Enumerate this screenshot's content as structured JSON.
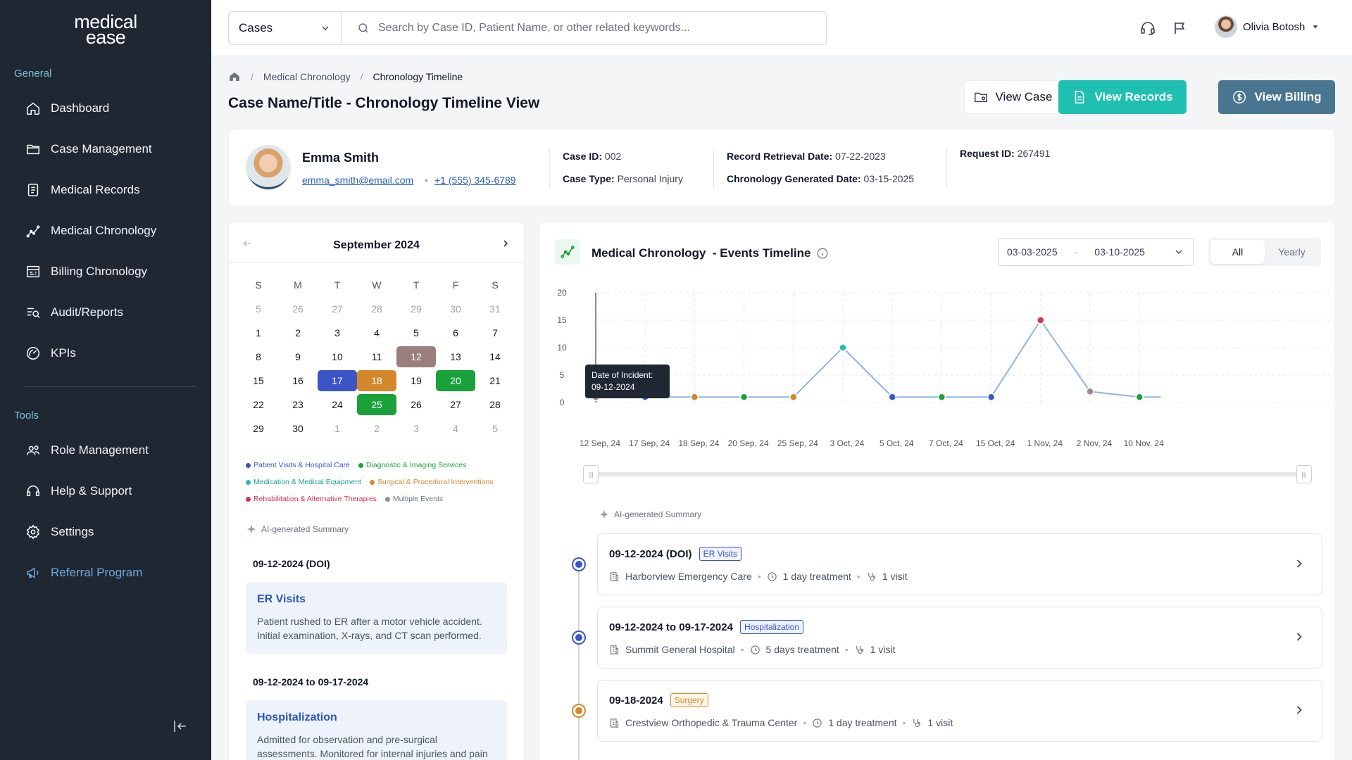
{
  "brand": {
    "line1": "medical",
    "line2": "ease"
  },
  "sidebar": {
    "general_label": "General",
    "tools_label": "Tools",
    "items": [
      {
        "label": "Dashboard",
        "icon": "home-icon"
      },
      {
        "label": "Case Management",
        "icon": "folder-icon"
      },
      {
        "label": "Medical Records",
        "icon": "records-icon"
      },
      {
        "label": "Medical Chronology",
        "icon": "chart-line-icon"
      },
      {
        "label": "Billing Chronology",
        "icon": "billing-icon"
      },
      {
        "label": "Audit/Reports",
        "icon": "audit-icon"
      },
      {
        "label": "KPIs",
        "icon": "kpi-icon"
      }
    ],
    "tools": [
      {
        "label": "Role Management",
        "icon": "users-icon"
      },
      {
        "label": "Help & Support",
        "icon": "headset-icon"
      },
      {
        "label": "Settings",
        "icon": "gear-icon"
      },
      {
        "label": "Referral Program",
        "icon": "megaphone-icon"
      }
    ]
  },
  "topbar": {
    "select_value": "Cases",
    "search_placeholder": "Search by Case ID, Patient Name, or other related keywords...",
    "user_name": "Olivia Botosh"
  },
  "breadcrumb": {
    "item1": "Medical Chronology",
    "item2": "Chronology Timeline",
    "sep": "/"
  },
  "page_title": "Case Name/Title - Chronology Timeline View",
  "actions": {
    "view_case": "View Case",
    "view_records": "View Records",
    "view_billing": "View Billing"
  },
  "patient": {
    "name": "Emma Smith",
    "email": "emma_smith@email.com",
    "phone": "+1 (555) 345-6789",
    "case_id_label": "Case ID:",
    "case_id": "002",
    "case_type_label": "Case Type:",
    "case_type": "Personal Injury",
    "retrieval_label": "Record Retrieval Date:",
    "retrieval": "07-22-2023",
    "generated_label": "Chronology Generated Date:",
    "generated": "03-15-2025",
    "request_label": "Request ID:",
    "request": "267491"
  },
  "calendar": {
    "month": "September 2024",
    "weekdays": [
      "S",
      "M",
      "T",
      "W",
      "T",
      "F",
      "S"
    ],
    "weeks": [
      [
        {
          "d": "5",
          "dim": true
        },
        {
          "d": "26",
          "dim": true
        },
        {
          "d": "27",
          "dim": true
        },
        {
          "d": "28",
          "dim": true
        },
        {
          "d": "29",
          "dim": true
        },
        {
          "d": "30",
          "dim": true
        },
        {
          "d": "31",
          "dim": true
        }
      ],
      [
        {
          "d": "1"
        },
        {
          "d": "2"
        },
        {
          "d": "3"
        },
        {
          "d": "4"
        },
        {
          "d": "5"
        },
        {
          "d": "6"
        },
        {
          "d": "7"
        }
      ],
      [
        {
          "d": "8"
        },
        {
          "d": "9"
        },
        {
          "d": "10"
        },
        {
          "d": "11"
        },
        {
          "d": "12",
          "color": "#9b7f7c"
        },
        {
          "d": "13"
        },
        {
          "d": "14"
        }
      ],
      [
        {
          "d": "15"
        },
        {
          "d": "16"
        },
        {
          "d": "17",
          "color": "#3b55c8"
        },
        {
          "d": "18",
          "color": "#d4882b"
        },
        {
          "d": "19"
        },
        {
          "d": "20",
          "color": "#19a23a"
        },
        {
          "d": "21"
        }
      ],
      [
        {
          "d": "22"
        },
        {
          "d": "23"
        },
        {
          "d": "24"
        },
        {
          "d": "25",
          "color": "#19a23a"
        },
        {
          "d": "26"
        },
        {
          "d": "27"
        },
        {
          "d": "28"
        }
      ],
      [
        {
          "d": "29"
        },
        {
          "d": "30"
        },
        {
          "d": "1",
          "dim": true
        },
        {
          "d": "2",
          "dim": true
        },
        {
          "d": "3",
          "dim": true
        },
        {
          "d": "4",
          "dim": true
        },
        {
          "d": "5",
          "dim": true
        }
      ]
    ],
    "legend": [
      {
        "label": "Patient Visits & Hospital Care",
        "color": "#3b55c8"
      },
      {
        "label": "Diagnostic & Imaging Services",
        "color": "#19a23a"
      },
      {
        "label": "Medication & Medical Equipment",
        "color": "#1fbfb0"
      },
      {
        "label": "Surgical & Procedural Interventions",
        "color": "#d4882b"
      },
      {
        "label": "Rehabilitation & Alternative Therapies",
        "color": "#d9324a"
      },
      {
        "label": "Multiple Events",
        "color": "#9b8c8a"
      }
    ],
    "ai_label": "AI-generated Summary",
    "summaries": [
      {
        "date": "09-12-2024 (DOI)",
        "title": "ER Visits",
        "desc": "Patient rushed to ER after a motor vehicle accident. Initial examination, X-rays, and CT scan performed."
      },
      {
        "date": "09-12-2024 to 09-17-2024",
        "title": "Hospitalization",
        "desc": "Admitted for observation and pre-surgical assessments. Monitored for internal injuries and pain"
      }
    ]
  },
  "timeline": {
    "title": "Medical Chronology  - Events Timeline",
    "date_from": "03-03-2025",
    "date_sep": "-",
    "date_to": "03-10-2025",
    "toggle_all": "All",
    "toggle_yearly": "Yearly",
    "tooltip_line1": "Date of Incident:",
    "tooltip_line2": "09-12-2024",
    "ai_label": "AI-generated Summary",
    "events": [
      {
        "date": "09-12-2024 (DOI)",
        "badge": "ER Visits",
        "badge_color": "#3b55c8",
        "badge_bg": "#eef2fd",
        "facility": "Harborview Emergency Care",
        "duration": "1 day treatment",
        "visits": "1 visit",
        "node_color": "#3b55c8"
      },
      {
        "date": "09-12-2024 to 09-17-2024",
        "badge": "Hospitalization",
        "badge_color": "#3b55c8",
        "badge_bg": "#eef2fd",
        "facility": "Summit General Hospital",
        "duration": "5 days treatment",
        "visits": "1 visit",
        "node_color": "#3b55c8"
      },
      {
        "date": "09-18-2024",
        "badge": "Surgery",
        "badge_color": "#d4882b",
        "badge_bg": "#fdf5e8",
        "facility": "Crestview Orthopedic & Trauma Center",
        "duration": "1 day treatment",
        "visits": "1 visit",
        "node_color": "#d4882b"
      }
    ]
  },
  "chart_data": {
    "type": "line",
    "categories": [
      "12 Sep, 24",
      "17 Sep, 24",
      "18 Sep, 24",
      "20 Sep, 24",
      "25 Sep, 24",
      "3 Oct, 24",
      "5 Oct, 24",
      "7 Oct, 24",
      "15 Oct, 24",
      "1 Nov, 24",
      "2 Nov, 24",
      "10 Nov, 24"
    ],
    "values": [
      1,
      1,
      1,
      1,
      1,
      10,
      1,
      1,
      1,
      15,
      2,
      1
    ],
    "point_colors": [
      "#9b8c8a",
      "#3b55c8",
      "#d4882b",
      "#19a23a",
      "#d4882b",
      "#1fbfb0",
      "#3b55c8",
      "#19a23a",
      "#3b55c8",
      "#d9324a",
      "#9b8c8a",
      "#19a23a"
    ],
    "y_ticks": [
      "0",
      "5",
      "10",
      "15",
      "20"
    ],
    "ylim": [
      0,
      20
    ],
    "line_color": "#8fb4e8",
    "grid": true
  }
}
